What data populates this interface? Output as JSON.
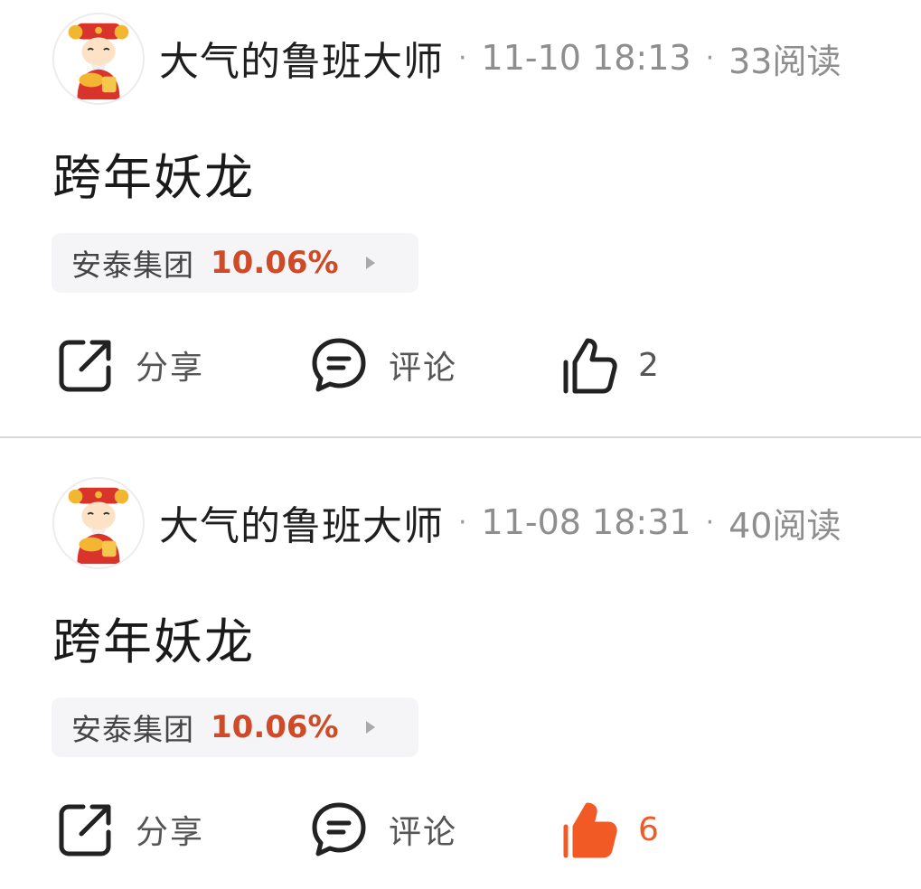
{
  "posts": [
    {
      "author": "大气的鲁班大师",
      "time": "11-10 18:13",
      "reads": "33阅读",
      "title": "跨年妖龙",
      "stock": {
        "name": "安泰集团",
        "change": "10.06%"
      },
      "actions": {
        "share": "分享",
        "comment": "评论",
        "likes": "2",
        "liked": false
      }
    },
    {
      "author": "大气的鲁班大师",
      "time": "11-08 18:31",
      "reads": "40阅读",
      "title": "跨年妖龙",
      "stock": {
        "name": "安泰集团",
        "change": "10.06%"
      },
      "actions": {
        "share": "分享",
        "comment": "评论",
        "likes": "6",
        "liked": true
      }
    }
  ],
  "colors": {
    "stock_up": "#cf4a26",
    "like_active": "#f15a24",
    "meta_gray": "#8e8e8e",
    "tag_bg": "#f5f5f7"
  },
  "icons": {
    "avatar": "wealth-god-avatar",
    "share": "share-icon",
    "comment": "comment-icon",
    "like": "thumbs-up-icon",
    "tag_arrow": "triangle-right-icon"
  }
}
